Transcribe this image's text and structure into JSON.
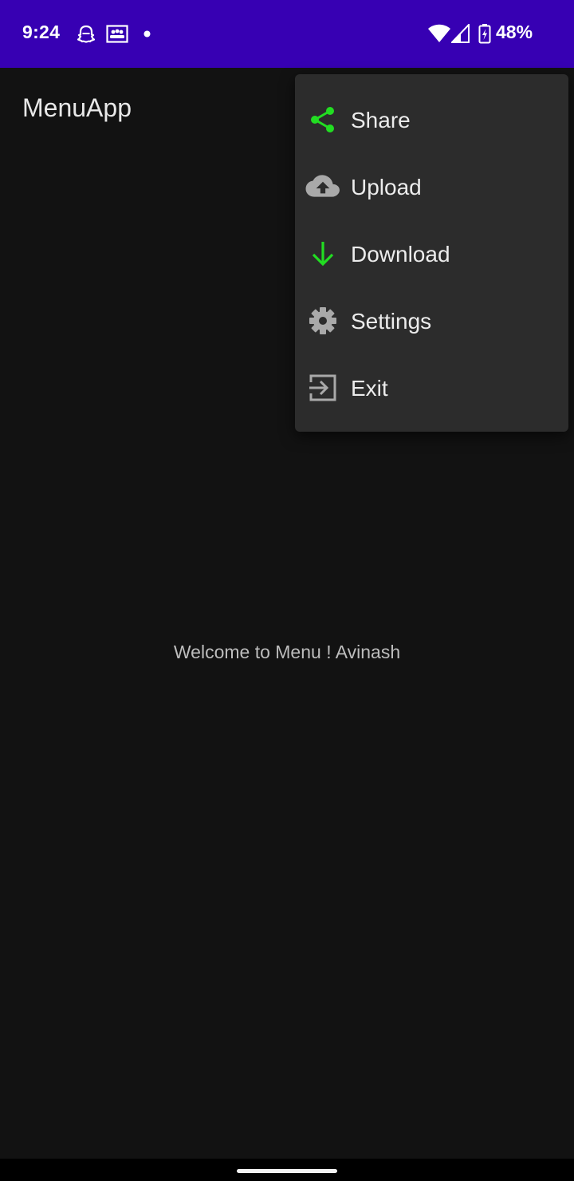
{
  "status_bar": {
    "time": "9:24",
    "battery_percent": "48%",
    "background_color": "#3700B3",
    "icons": [
      "snapchat-ghost-icon",
      "gallery-icon",
      "notification-dot-icon",
      "wifi-icon",
      "signal-icon",
      "battery-charging-icon"
    ]
  },
  "app_bar": {
    "title": "MenuApp"
  },
  "main": {
    "welcome_text": "Welcome to Menu ! Avinash"
  },
  "menu": {
    "items": [
      {
        "label": "Share",
        "icon": "share-icon",
        "icon_color": "#22DD22"
      },
      {
        "label": "Upload",
        "icon": "cloud-upload-icon",
        "icon_color": "#A9A9A9"
      },
      {
        "label": "Download",
        "icon": "download-arrow-icon",
        "icon_color": "#22DD22"
      },
      {
        "label": "Settings",
        "icon": "gear-icon",
        "icon_color": "#A9A9A9"
      },
      {
        "label": "Exit",
        "icon": "exit-icon",
        "icon_color": "#A9A9A9"
      }
    ]
  },
  "colors": {
    "background": "#121212",
    "menu_background": "#2C2C2C",
    "accent_green": "#22DD22"
  }
}
